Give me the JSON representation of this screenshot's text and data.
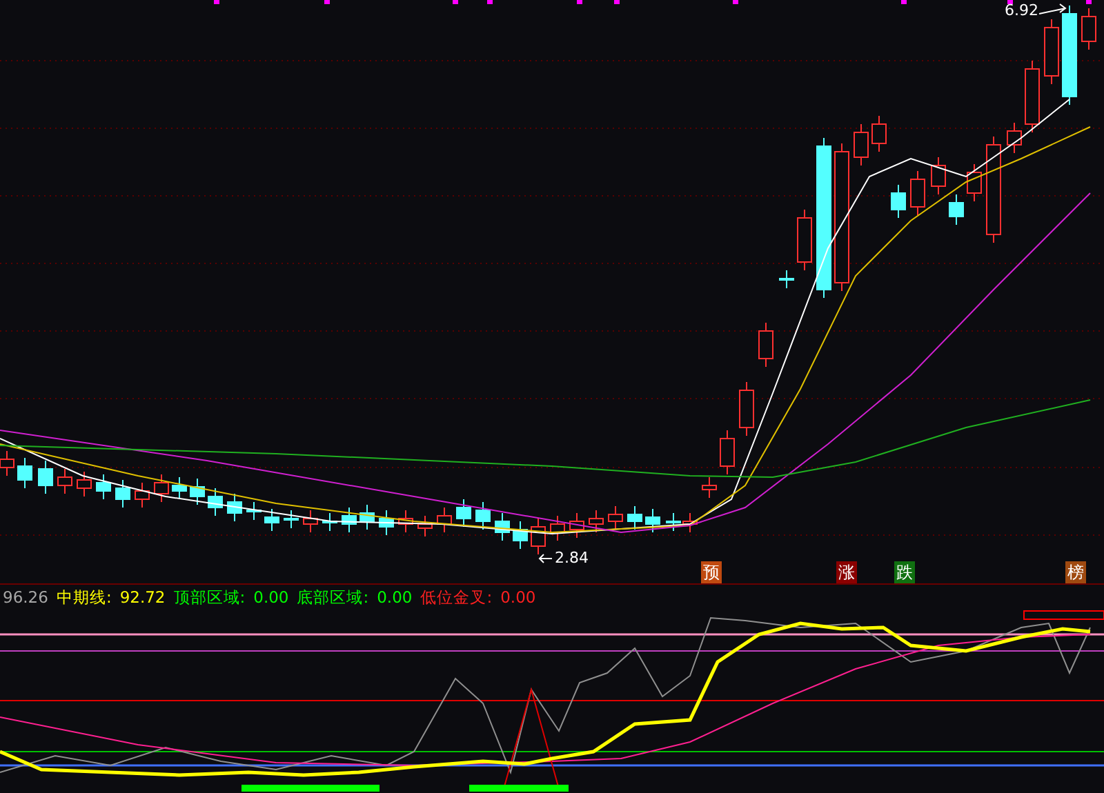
{
  "price_chart": {
    "high_label": "6.92",
    "low_label": "2.84",
    "signals": [
      {
        "label": "预",
        "color": "#c04a10"
      },
      {
        "label": "涨",
        "color": "#8b0000"
      },
      {
        "label": "跌",
        "color": "#107010"
      },
      {
        "label": "榜",
        "color": "#a04a10"
      }
    ]
  },
  "indicator": {
    "legend": [
      {
        "value": "96.26",
        "color": "#a8a8a8"
      },
      {
        "label": "中期线:",
        "value": "92.72",
        "color": "#ffff00"
      },
      {
        "label": "顶部区域:",
        "value": "0.00",
        "color": "#00ff00"
      },
      {
        "label": "底部区域:",
        "value": "0.00",
        "color": "#00ff00"
      },
      {
        "label": "低位金叉:",
        "value": "0.00",
        "color": "#ff2020"
      }
    ]
  }
}
